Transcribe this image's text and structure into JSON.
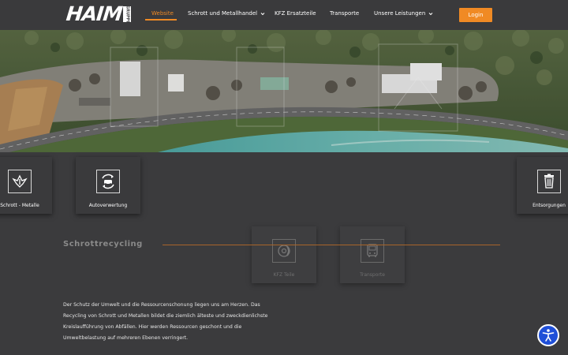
{
  "header": {
    "logo_text": "HAIM",
    "logo_badge": "GRUPPE",
    "nav": [
      {
        "label": "Website",
        "active": true,
        "dropdown": false
      },
      {
        "label": "Schrott und Metallhandel",
        "active": false,
        "dropdown": true
      },
      {
        "label": "KFZ Ersatzteile",
        "active": false,
        "dropdown": false
      },
      {
        "label": "Transporte",
        "active": false,
        "dropdown": false
      },
      {
        "label": "Unsere Leistungen",
        "active": false,
        "dropdown": true
      }
    ],
    "login_label": "Login"
  },
  "tiles": [
    {
      "label": "Schrott - Metalle",
      "icon": "scrap-metal-icon"
    },
    {
      "label": "Autoverwertung",
      "icon": "car-recycling-icon"
    },
    {
      "label": "Entsorgungen",
      "icon": "trash-bin-icon"
    },
    {
      "label": "KFZ Teile",
      "icon": "brake-disc-icon"
    },
    {
      "label": "Transporte",
      "icon": "bus-icon"
    }
  ],
  "section": {
    "title": "Schrottrecycling",
    "body": "Der Schutz der Umwelt und die Ressourcenschonung liegen uns am Herzen. Das Recycling von Schrott und Metallen bildet die ziemlich älteste und zweckdienlichste Kreislaufführung von Abfällen. Hier werden Ressourcen geschont und die Umweltbelastung auf mehreren Ebenen verringert."
  },
  "colors": {
    "accent": "#f08a24",
    "background": "#3b3b3d",
    "accessibility_button": "#1f4fd8"
  },
  "accessibility_icon": "accessibility-icon"
}
